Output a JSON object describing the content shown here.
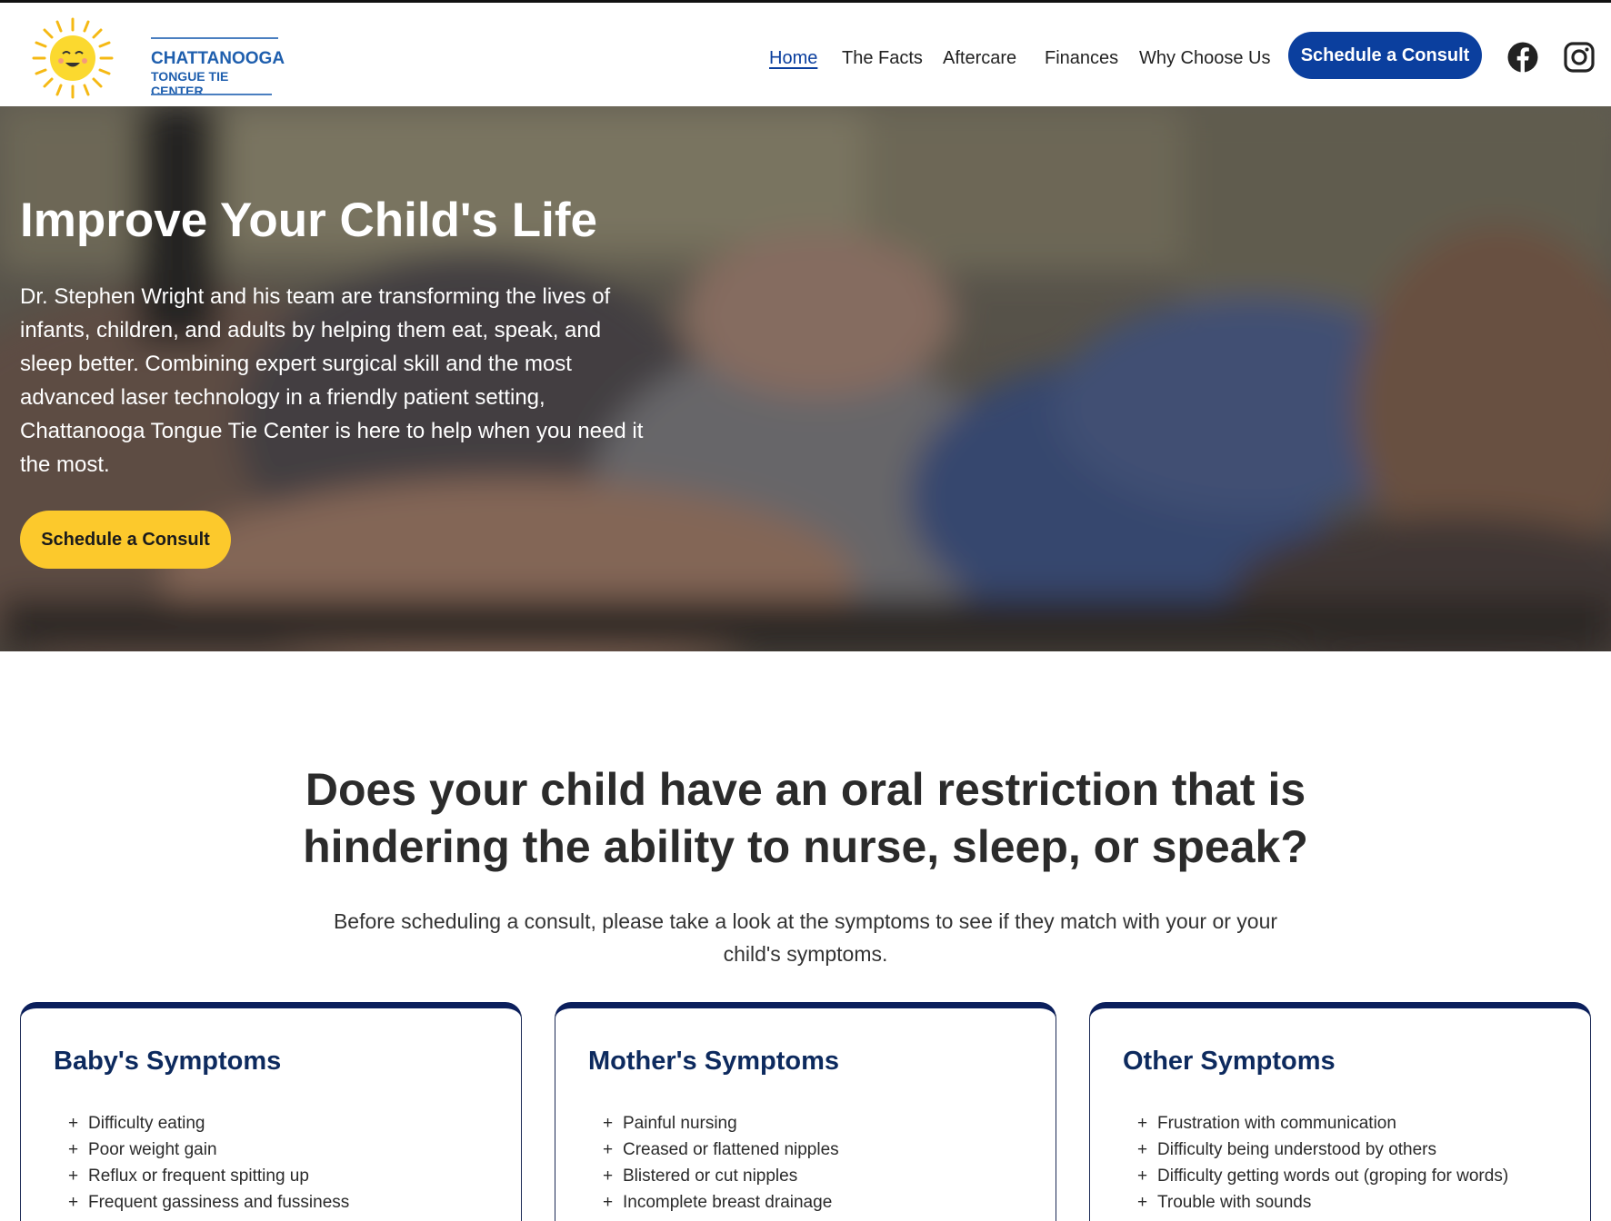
{
  "brand": {
    "line1": "CHATTANOOGA",
    "line2": "TONGUE TIE CENTER",
    "logo_icon": "smiling-sun-icon",
    "sun_color": "#fbd92f",
    "brand_color": "#1f5fae"
  },
  "nav": {
    "items": [
      "Home",
      "The Facts",
      "Aftercare",
      "Finances",
      "Why Choose Us"
    ],
    "active": "Home",
    "cta": "Schedule a Consult",
    "social": [
      "facebook-icon",
      "instagram-icon"
    ]
  },
  "hero": {
    "title": "Improve Your Child's Life",
    "body": "Dr. Stephen Wright and his team are transforming the lives of infants, children, and adults by helping them eat, speak, and sleep better. Combining expert surgical skill and the most advanced laser technology in a friendly patient setting, Chattanooga Tongue Tie Center is here to help when you need it the most.",
    "cta": "Schedule a Consult"
  },
  "symptoms": {
    "title": "Does your child have an oral restriction that is hindering the ability to nurse, sleep, or speak?",
    "subtitle": "Before scheduling a consult, please take a look at the symptoms to see if they match with your or your child's symptoms.",
    "cards": [
      {
        "title": "Baby's Symptoms",
        "items": [
          "Difficulty eating",
          "Poor weight gain",
          "Reflux or frequent spitting up",
          "Frequent gassiness and fussiness"
        ]
      },
      {
        "title": "Mother's Symptoms",
        "items": [
          "Painful nursing",
          "Creased or flattened nipples",
          "Blistered or cut nipples",
          "Incomplete breast drainage"
        ]
      },
      {
        "title": "Other Symptoms",
        "items": [
          "Frustration with communication",
          "Difficulty being understood by others",
          "Difficulty getting words out (groping for words)",
          "Trouble with sounds"
        ]
      }
    ]
  },
  "colors": {
    "primary": "#0b3f9e",
    "accent": "#fcc92c",
    "card_border": "#0b1f5c",
    "card_title": "#0d2a5e"
  }
}
